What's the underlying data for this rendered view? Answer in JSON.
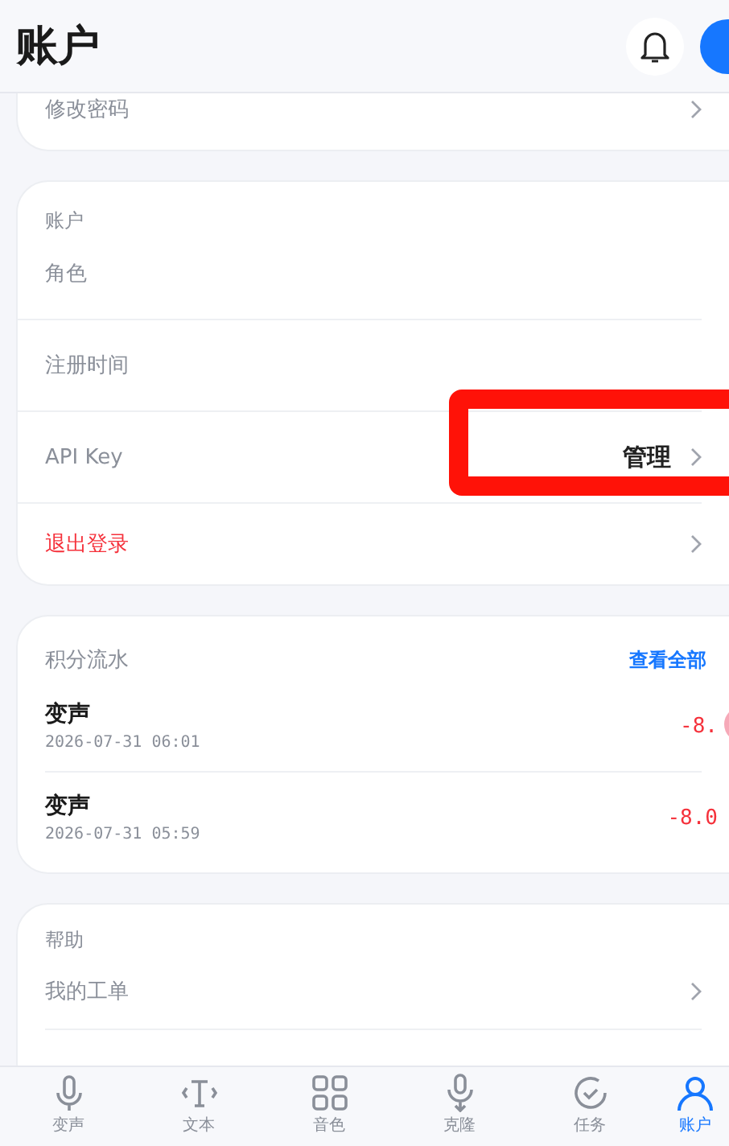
{
  "header": {
    "title": "账户"
  },
  "top_card": {
    "rows": [
      {
        "label": "修改密码",
        "kind": "info",
        "chevron": true,
        "highlighted": false
      }
    ]
  },
  "account_card": {
    "title": "账户",
    "rows": [
      {
        "label": "角色",
        "kind": "info",
        "chevron": false,
        "highlighted": false
      },
      {
        "label": "注册时间",
        "kind": "info",
        "chevron": false,
        "highlighted": false
      },
      {
        "label": "API Key",
        "value": "管理",
        "kind": "info",
        "chevron": true,
        "highlighted": true
      },
      {
        "label": "退出登录",
        "kind": "danger",
        "chevron": true,
        "highlighted": false
      }
    ]
  },
  "points_card": {
    "title": "积分流水",
    "action": "查看全部",
    "entries": [
      {
        "name": "变声",
        "time": "2026-07-31 06:01",
        "amount": "-8."
      },
      {
        "name": "变声",
        "time": "2026-07-31 05:59",
        "amount": "-8.0"
      }
    ]
  },
  "help_card": {
    "title": "帮助",
    "rows": [
      {
        "label": "我的工单",
        "kind": "info",
        "chevron": true,
        "highlighted": false
      }
    ]
  },
  "tabs": [
    {
      "label": "变声",
      "kind": "mic",
      "selected": false
    },
    {
      "label": "文本",
      "kind": "text",
      "selected": false
    },
    {
      "label": "音色",
      "kind": "grid",
      "selected": false
    },
    {
      "label": "克隆",
      "kind": "mic2",
      "selected": false
    },
    {
      "label": "任务",
      "kind": "check",
      "selected": false
    },
    {
      "label": "账户",
      "kind": "user",
      "selected": true
    }
  ]
}
